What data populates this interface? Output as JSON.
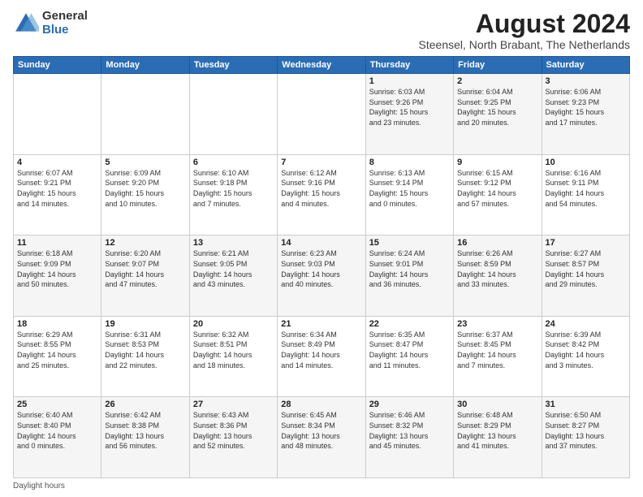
{
  "logo": {
    "general": "General",
    "blue": "Blue"
  },
  "title": "August 2024",
  "subtitle": "Steensel, North Brabant, The Netherlands",
  "days_of_week": [
    "Sunday",
    "Monday",
    "Tuesday",
    "Wednesday",
    "Thursday",
    "Friday",
    "Saturday"
  ],
  "footer": "Daylight hours",
  "weeks": [
    [
      {
        "day": "",
        "info": ""
      },
      {
        "day": "",
        "info": ""
      },
      {
        "day": "",
        "info": ""
      },
      {
        "day": "",
        "info": ""
      },
      {
        "day": "1",
        "info": "Sunrise: 6:03 AM\nSunset: 9:26 PM\nDaylight: 15 hours\nand 23 minutes."
      },
      {
        "day": "2",
        "info": "Sunrise: 6:04 AM\nSunset: 9:25 PM\nDaylight: 15 hours\nand 20 minutes."
      },
      {
        "day": "3",
        "info": "Sunrise: 6:06 AM\nSunset: 9:23 PM\nDaylight: 15 hours\nand 17 minutes."
      }
    ],
    [
      {
        "day": "4",
        "info": "Sunrise: 6:07 AM\nSunset: 9:21 PM\nDaylight: 15 hours\nand 14 minutes."
      },
      {
        "day": "5",
        "info": "Sunrise: 6:09 AM\nSunset: 9:20 PM\nDaylight: 15 hours\nand 10 minutes."
      },
      {
        "day": "6",
        "info": "Sunrise: 6:10 AM\nSunset: 9:18 PM\nDaylight: 15 hours\nand 7 minutes."
      },
      {
        "day": "7",
        "info": "Sunrise: 6:12 AM\nSunset: 9:16 PM\nDaylight: 15 hours\nand 4 minutes."
      },
      {
        "day": "8",
        "info": "Sunrise: 6:13 AM\nSunset: 9:14 PM\nDaylight: 15 hours\nand 0 minutes."
      },
      {
        "day": "9",
        "info": "Sunrise: 6:15 AM\nSunset: 9:12 PM\nDaylight: 14 hours\nand 57 minutes."
      },
      {
        "day": "10",
        "info": "Sunrise: 6:16 AM\nSunset: 9:11 PM\nDaylight: 14 hours\nand 54 minutes."
      }
    ],
    [
      {
        "day": "11",
        "info": "Sunrise: 6:18 AM\nSunset: 9:09 PM\nDaylight: 14 hours\nand 50 minutes."
      },
      {
        "day": "12",
        "info": "Sunrise: 6:20 AM\nSunset: 9:07 PM\nDaylight: 14 hours\nand 47 minutes."
      },
      {
        "day": "13",
        "info": "Sunrise: 6:21 AM\nSunset: 9:05 PM\nDaylight: 14 hours\nand 43 minutes."
      },
      {
        "day": "14",
        "info": "Sunrise: 6:23 AM\nSunset: 9:03 PM\nDaylight: 14 hours\nand 40 minutes."
      },
      {
        "day": "15",
        "info": "Sunrise: 6:24 AM\nSunset: 9:01 PM\nDaylight: 14 hours\nand 36 minutes."
      },
      {
        "day": "16",
        "info": "Sunrise: 6:26 AM\nSunset: 8:59 PM\nDaylight: 14 hours\nand 33 minutes."
      },
      {
        "day": "17",
        "info": "Sunrise: 6:27 AM\nSunset: 8:57 PM\nDaylight: 14 hours\nand 29 minutes."
      }
    ],
    [
      {
        "day": "18",
        "info": "Sunrise: 6:29 AM\nSunset: 8:55 PM\nDaylight: 14 hours\nand 25 minutes."
      },
      {
        "day": "19",
        "info": "Sunrise: 6:31 AM\nSunset: 8:53 PM\nDaylight: 14 hours\nand 22 minutes."
      },
      {
        "day": "20",
        "info": "Sunrise: 6:32 AM\nSunset: 8:51 PM\nDaylight: 14 hours\nand 18 minutes."
      },
      {
        "day": "21",
        "info": "Sunrise: 6:34 AM\nSunset: 8:49 PM\nDaylight: 14 hours\nand 14 minutes."
      },
      {
        "day": "22",
        "info": "Sunrise: 6:35 AM\nSunset: 8:47 PM\nDaylight: 14 hours\nand 11 minutes."
      },
      {
        "day": "23",
        "info": "Sunrise: 6:37 AM\nSunset: 8:45 PM\nDaylight: 14 hours\nand 7 minutes."
      },
      {
        "day": "24",
        "info": "Sunrise: 6:39 AM\nSunset: 8:42 PM\nDaylight: 14 hours\nand 3 minutes."
      }
    ],
    [
      {
        "day": "25",
        "info": "Sunrise: 6:40 AM\nSunset: 8:40 PM\nDaylight: 14 hours\nand 0 minutes."
      },
      {
        "day": "26",
        "info": "Sunrise: 6:42 AM\nSunset: 8:38 PM\nDaylight: 13 hours\nand 56 minutes."
      },
      {
        "day": "27",
        "info": "Sunrise: 6:43 AM\nSunset: 8:36 PM\nDaylight: 13 hours\nand 52 minutes."
      },
      {
        "day": "28",
        "info": "Sunrise: 6:45 AM\nSunset: 8:34 PM\nDaylight: 13 hours\nand 48 minutes."
      },
      {
        "day": "29",
        "info": "Sunrise: 6:46 AM\nSunset: 8:32 PM\nDaylight: 13 hours\nand 45 minutes."
      },
      {
        "day": "30",
        "info": "Sunrise: 6:48 AM\nSunset: 8:29 PM\nDaylight: 13 hours\nand 41 minutes."
      },
      {
        "day": "31",
        "info": "Sunrise: 6:50 AM\nSunset: 8:27 PM\nDaylight: 13 hours\nand 37 minutes."
      }
    ]
  ]
}
